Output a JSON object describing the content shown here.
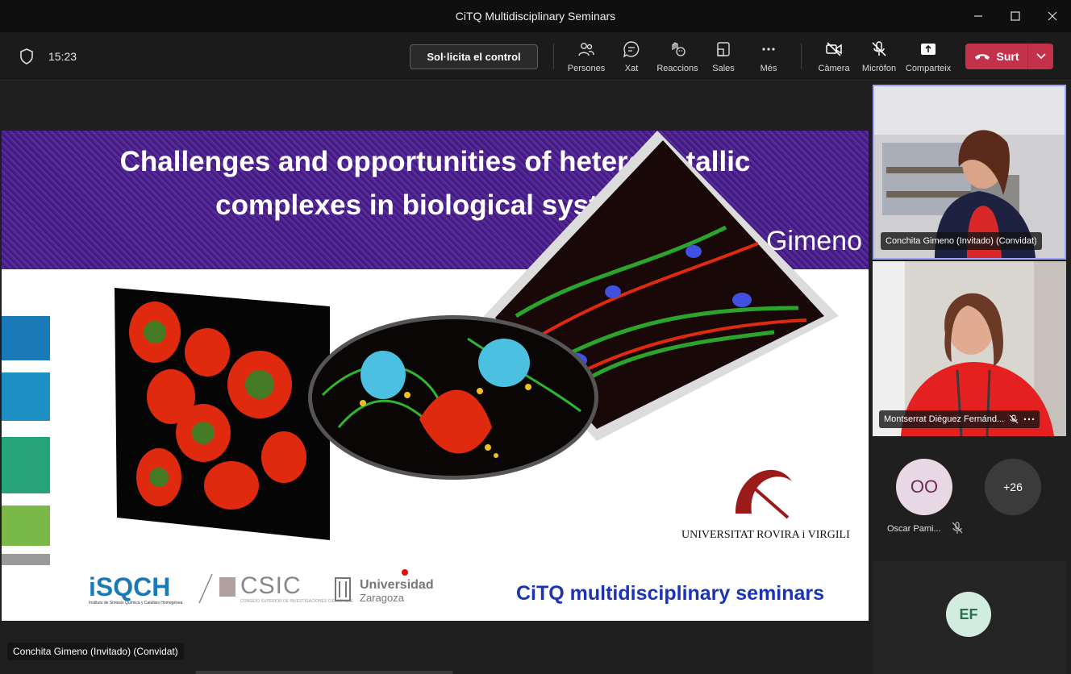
{
  "window": {
    "title": "CiTQ Multidisciplinary Seminars"
  },
  "toolbar": {
    "time": "15:23",
    "request_control_label": "Sol·licita el control",
    "tools": [
      {
        "label": "Persones",
        "icon": "people-icon"
      },
      {
        "label": "Xat",
        "icon": "chat-icon"
      },
      {
        "label": "Reaccions",
        "icon": "reactions-icon"
      },
      {
        "label": "Sales",
        "icon": "rooms-icon"
      },
      {
        "label": "Més",
        "icon": "more-icon"
      }
    ],
    "media": [
      {
        "label": "Càmera",
        "icon": "camera-off-icon"
      },
      {
        "label": "Micròfon",
        "icon": "mic-off-icon"
      },
      {
        "label": "Comparteix",
        "icon": "share-icon"
      }
    ],
    "leave_label": "Surt"
  },
  "slide": {
    "title_line1": "Challenges and opportunities of heterometallic",
    "title_line2": "complexes in biological systems",
    "author": "M. Concepción Gimeno",
    "series": "CiTQ multidisciplinary seminars",
    "university": "UNIVERSITAT ROVIRA i VIRGILI",
    "logo_isqch": "iSQCH",
    "logo_isqch_sub": "Instituto de Síntesis Química y Catálisis Homogénea",
    "logo_csic": "CSIC",
    "logo_csic_sub": "CONSEJO SUPERIOR DE INVESTIGACIONES CIENTÍFICAS",
    "logo_uz_line1": "Universidad",
    "logo_uz_line2": "Zaragoza"
  },
  "presenter_label": "Conchita Gimeno (Invitado) (Convidat)",
  "participants": {
    "tile1_name": "Conchita Gimeno (Invitado) (Convidat)",
    "tile2_name": "Montserrat Diéguez Fernánd...",
    "oo_initials": "OO",
    "oo_name": "Oscar Pami...",
    "more_count": "+26",
    "ef_initials": "EF"
  },
  "colors": {
    "accent": "#9ea2ff",
    "leave": "#c4314b",
    "slide_header": "#4b2289",
    "series_text": "#1c33b8"
  }
}
